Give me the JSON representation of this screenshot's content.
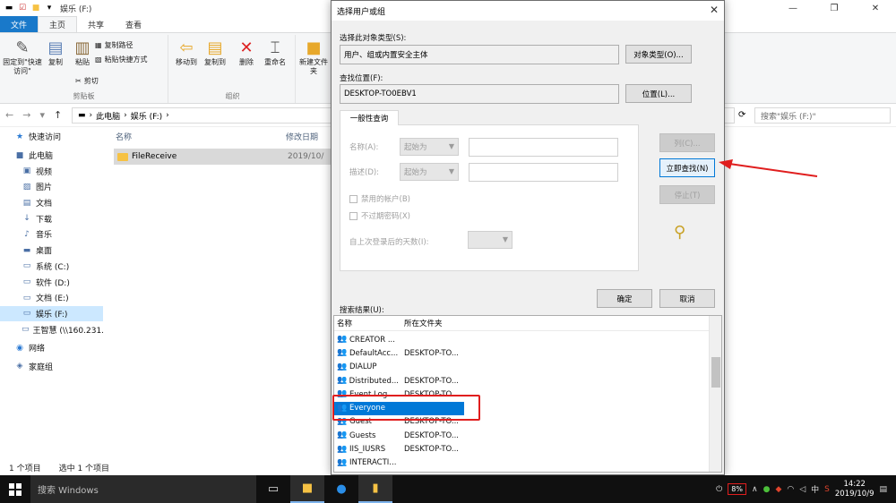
{
  "explorer": {
    "title": "娱乐 (F:)",
    "tabs": [
      "文件",
      "主页",
      "共享",
      "查看"
    ],
    "ribbon": {
      "pin_label": "固定到\"快速访问\"",
      "copy_label": "复制",
      "paste_label": "粘贴",
      "copy_path_label": "复制路径",
      "paste_shortcut_label": "粘贴快捷方式",
      "cut_label": "剪切",
      "clipboard_group": "剪贴板",
      "move_to_label": "移动到",
      "copy_to_label": "复制到",
      "delete_label": "删除",
      "rename_label": "重命名",
      "organize_group": "组织",
      "new_folder_label": "新建文件夹"
    },
    "address": {
      "parts": [
        "此电脑",
        "娱乐 (F:)"
      ],
      "search_placeholder": "搜索\"娱乐 (F:)\""
    },
    "nav": [
      {
        "icon": "★",
        "label": "快速访问"
      },
      {
        "icon": "■",
        "label": "此电脑"
      },
      {
        "icon": "▣",
        "label": "视频"
      },
      {
        "icon": "▨",
        "label": "图片"
      },
      {
        "icon": "▤",
        "label": "文档"
      },
      {
        "icon": "↓",
        "label": "下载"
      },
      {
        "icon": "♪",
        "label": "音乐"
      },
      {
        "icon": "▬",
        "label": "桌面"
      },
      {
        "icon": "▭",
        "label": "系统 (C:)"
      },
      {
        "icon": "▭",
        "label": "软件 (D:)"
      },
      {
        "icon": "▭",
        "label": "文档 (E:)"
      },
      {
        "icon": "▭",
        "label": "娱乐 (F:)"
      },
      {
        "icon": "▭",
        "label": "王智慧 (\\\\160.231."
      },
      {
        "icon": "◉",
        "label": "网络"
      },
      {
        "icon": "◈",
        "label": "家庭组"
      }
    ],
    "columns": {
      "name": "名称",
      "modified": "修改日期"
    },
    "file": {
      "name": "FileReceive",
      "date": "2019/10/"
    },
    "status": {
      "count": "1 个项目",
      "selected": "选中 1 个项目"
    }
  },
  "dialog": {
    "title": "选择用户或组",
    "object_type_label": "选择此对象类型(S):",
    "object_type_value": "用户、组或内置安全主体",
    "object_type_button": "对象类型(O)...",
    "location_label": "查找位置(F):",
    "location_value": "DESKTOP-TO0EBV1",
    "location_button": "位置(L)...",
    "query_tab": "一般性查询",
    "name_label": "名称(A):",
    "desc_label": "描述(D):",
    "starts_with": "起始为",
    "disabled_accounts": "禁用的帐户(B)",
    "no_expire": "不过期密码(X)",
    "days_label": "自上次登录后的天数(I):",
    "columns_button": "列(C)...",
    "find_now_button": "立即查找(N)",
    "stop_button": "停止(T)",
    "ok_button": "确定",
    "cancel_button": "取消",
    "results_label": "搜索结果(U):",
    "results_columns": {
      "name": "名称",
      "folder": "所在文件夹"
    },
    "results": [
      {
        "name": "CREATOR ...",
        "folder": ""
      },
      {
        "name": "DefaultAcc...",
        "folder": "DESKTOP-TO..."
      },
      {
        "name": "DIALUP",
        "folder": ""
      },
      {
        "name": "Distributed...",
        "folder": "DESKTOP-TO..."
      },
      {
        "name": "Event Log ...",
        "folder": "DESKTOP-TO..."
      },
      {
        "name": "Everyone",
        "folder": ""
      },
      {
        "name": "Guest",
        "folder": "DESKTOP-TO..."
      },
      {
        "name": "Guests",
        "folder": "DESKTOP-TO..."
      },
      {
        "name": "IIS_IUSRS",
        "folder": "DESKTOP-TO..."
      },
      {
        "name": "INTERACTI...",
        "folder": ""
      }
    ]
  },
  "taskbar": {
    "search_placeholder": "搜索 Windows",
    "battery": "8%",
    "ime": "中",
    "time": "14:22",
    "date": "2019/10/9"
  },
  "colors": {
    "accent": "#0078d7",
    "highlight": "#e01e1e",
    "folder": "#f6c244"
  }
}
